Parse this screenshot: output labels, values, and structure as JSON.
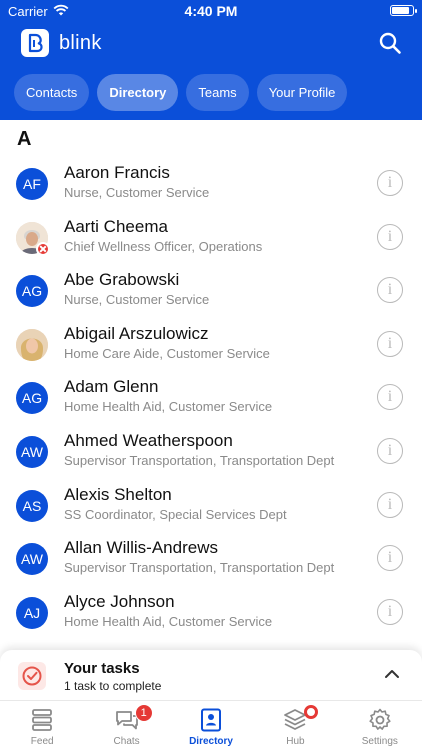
{
  "status_bar": {
    "carrier": "Carrier",
    "time": "4:40 PM",
    "battery_level": 0.9
  },
  "app": {
    "name": "blink"
  },
  "tabs": [
    {
      "label": "Contacts",
      "active": false
    },
    {
      "label": "Directory",
      "active": true
    },
    {
      "label": "Teams",
      "active": false
    },
    {
      "label": "Your Profile",
      "active": false
    }
  ],
  "section": {
    "letter": "A"
  },
  "contacts": [
    {
      "initials": "AF",
      "name": "Aaron Francis",
      "title": "Nurse, Customer Service",
      "avatar": "initials"
    },
    {
      "initials": "",
      "name": "Aarti Cheema",
      "title": "Chief Wellness Officer, Operations",
      "avatar": "photo",
      "presence": "offline"
    },
    {
      "initials": "AG",
      "name": "Abe Grabowski",
      "title": "Nurse, Customer Service",
      "avatar": "initials"
    },
    {
      "initials": "",
      "name": "Abigail Arszulowicz",
      "title": "Home Care Aide, Customer Service",
      "avatar": "photo"
    },
    {
      "initials": "AG",
      "name": "Adam Glenn",
      "title": "Home Health Aid, Customer Service",
      "avatar": "initials"
    },
    {
      "initials": "AW",
      "name": "Ahmed Weatherspoon",
      "title": "Supervisor Transportation, Transportation Dept",
      "avatar": "initials"
    },
    {
      "initials": "AS",
      "name": "Alexis Shelton",
      "title": "SS Coordinator, Special Services Dept",
      "avatar": "initials"
    },
    {
      "initials": "AW",
      "name": "Allan Willis-Andrews",
      "title": "Supervisor Transportation, Transportation Dept",
      "avatar": "initials"
    },
    {
      "initials": "AJ",
      "name": "Alyce Johnson",
      "title": "Home Health Aid, Customer Service",
      "avatar": "initials"
    }
  ],
  "tasks": {
    "title": "Your tasks",
    "subtitle": "1 task to complete"
  },
  "bottom_nav": [
    {
      "label": "Feed",
      "icon": "feed-icon",
      "active": false
    },
    {
      "label": "Chats",
      "icon": "chats-icon",
      "active": false,
      "badge": "1"
    },
    {
      "label": "Directory",
      "icon": "directory-icon",
      "active": true
    },
    {
      "label": "Hub",
      "icon": "hub-icon",
      "active": false,
      "dot": true
    },
    {
      "label": "Settings",
      "icon": "gear-icon",
      "active": false
    }
  ],
  "colors": {
    "brand": "#0b4fd9",
    "badge": "#e53935"
  }
}
